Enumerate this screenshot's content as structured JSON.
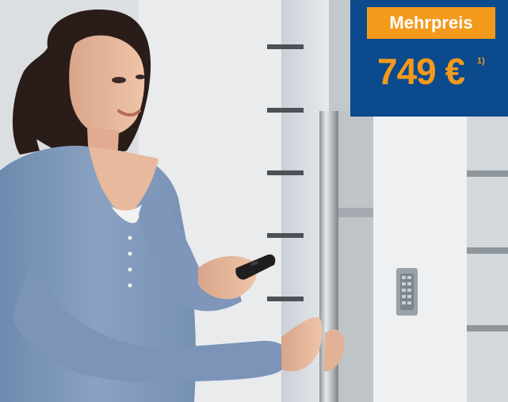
{
  "price_badge": {
    "label": "Mehrpreis",
    "price": "749 €",
    "footnote": "1)",
    "colors": {
      "panel": "#0b4a8c",
      "accent": "#f39a1c"
    }
  },
  "photo": {
    "icon": "woman-opening-front-door-with-remote-photo"
  }
}
